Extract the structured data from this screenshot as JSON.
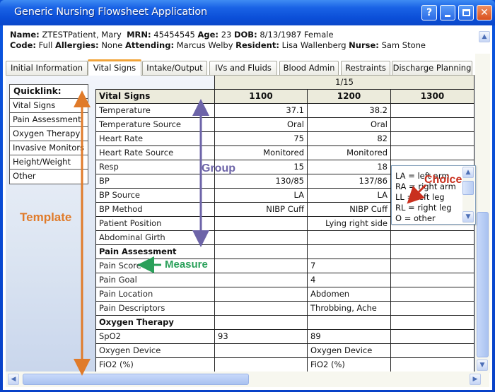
{
  "window": {
    "title": "Generic Nursing Flowsheet Application",
    "controls": {
      "help": "?",
      "minimize": "minimize",
      "maximize": "maximize",
      "close": "✕"
    }
  },
  "patient": {
    "name_label": "Name:",
    "name": "ZTESTPatient, Mary",
    "mrn_label": "MRN:",
    "mrn": "45454545",
    "age_label": "Age:",
    "age": "23",
    "dob_label": "DOB:",
    "dob": "8/13/1987 Female",
    "code_label": "Code:",
    "code": "Full",
    "allergies_label": "Allergies:",
    "allergies": "None",
    "attending_label": "Attending:",
    "attending": "Marcus Welby",
    "resident_label": "Resident:",
    "resident": "Lisa Wallenberg",
    "nurse_label": "Nurse:",
    "nurse": "Sam Stone"
  },
  "tabs": [
    {
      "label": "Initial Information",
      "active": false
    },
    {
      "label": "Vital Signs",
      "active": true
    },
    {
      "label": "Intake/Output",
      "active": false
    },
    {
      "label": "IVs and Fluids",
      "active": false
    },
    {
      "label": "Blood Admin",
      "active": false
    },
    {
      "label": "Restraints",
      "active": false
    },
    {
      "label": "Discharge Planning",
      "active": false
    }
  ],
  "quicklink": {
    "title": "Quicklink:",
    "items": [
      "Vital Signs",
      "Pain Assessment",
      "Oxygen Therapy",
      "Invasive Monitors",
      "Height/Weight",
      "Other"
    ]
  },
  "grid": {
    "date": "1/15",
    "group_header": "Vital Signs",
    "times": [
      "1100",
      "1200",
      "1300"
    ],
    "rows": [
      {
        "label": "Temperature",
        "values": [
          "37.1",
          "38.2",
          ""
        ],
        "align": "right"
      },
      {
        "label": "Temperature Source",
        "values": [
          "Oral",
          "Oral",
          ""
        ],
        "align": "right"
      },
      {
        "label": "Heart Rate",
        "values": [
          "75",
          "82",
          ""
        ],
        "align": "right"
      },
      {
        "label": "Heart Rate Source",
        "values": [
          "Monitored",
          "Monitored",
          ""
        ],
        "align": "right"
      },
      {
        "label": "Resp",
        "values": [
          "15",
          "18",
          ""
        ],
        "align": "right"
      },
      {
        "label": "BP",
        "values": [
          "130/85",
          "137/86",
          ""
        ],
        "align": "right"
      },
      {
        "label": "BP Source",
        "values": [
          "LA",
          "LA",
          ""
        ],
        "align": "right"
      },
      {
        "label": "BP Method",
        "values": [
          "NIBP Cuff",
          "NIBP Cuff",
          ""
        ],
        "align": "right"
      },
      {
        "label": "Patient Position",
        "values": [
          "",
          "Lying right side",
          ""
        ],
        "align": "right"
      },
      {
        "label": "Abdominal Girth",
        "values": [
          "",
          "",
          ""
        ],
        "align": "right"
      },
      {
        "label": "Pain Assessment",
        "values": [
          "",
          "",
          ""
        ],
        "group": true
      },
      {
        "label": "Pain Score",
        "values": [
          "",
          "7",
          ""
        ],
        "align": "left"
      },
      {
        "label": "Pain Goal",
        "values": [
          "",
          "4",
          ""
        ],
        "align": "left"
      },
      {
        "label": "Pain Location",
        "values": [
          "",
          "Abdomen",
          ""
        ],
        "align": "left"
      },
      {
        "label": "Pain Descriptors",
        "values": [
          "",
          "Throbbing, Ache",
          ""
        ],
        "align": "left"
      },
      {
        "label": "Oxygen Therapy",
        "values": [
          "",
          "",
          ""
        ],
        "group": true
      },
      {
        "label": "SpO2",
        "values": [
          "93",
          "89",
          ""
        ],
        "align": "left"
      },
      {
        "label": "Oxygen Device",
        "values": [
          "",
          "Oxygen Device",
          ""
        ],
        "align": "left"
      },
      {
        "label": "FiO2 (%)",
        "values": [
          "",
          "FiO2 (%)",
          ""
        ],
        "align": "left"
      }
    ]
  },
  "choice_list": {
    "items": [
      "LA = left arm",
      "RA = right arm",
      "LL = left leg",
      "RL = right leg",
      "O = other"
    ]
  },
  "annotations": {
    "template": "Template",
    "group": "Group",
    "measure": "Measure",
    "choice": "Choice",
    "colors": {
      "template": "#e07b2a",
      "group": "#6d64a8",
      "measure": "#2aa05a",
      "choice": "#c9301e"
    }
  },
  "scrollbars": {
    "up_icon": "▲",
    "down_icon": "▼",
    "left_icon": "◀",
    "right_icon": "▶"
  }
}
